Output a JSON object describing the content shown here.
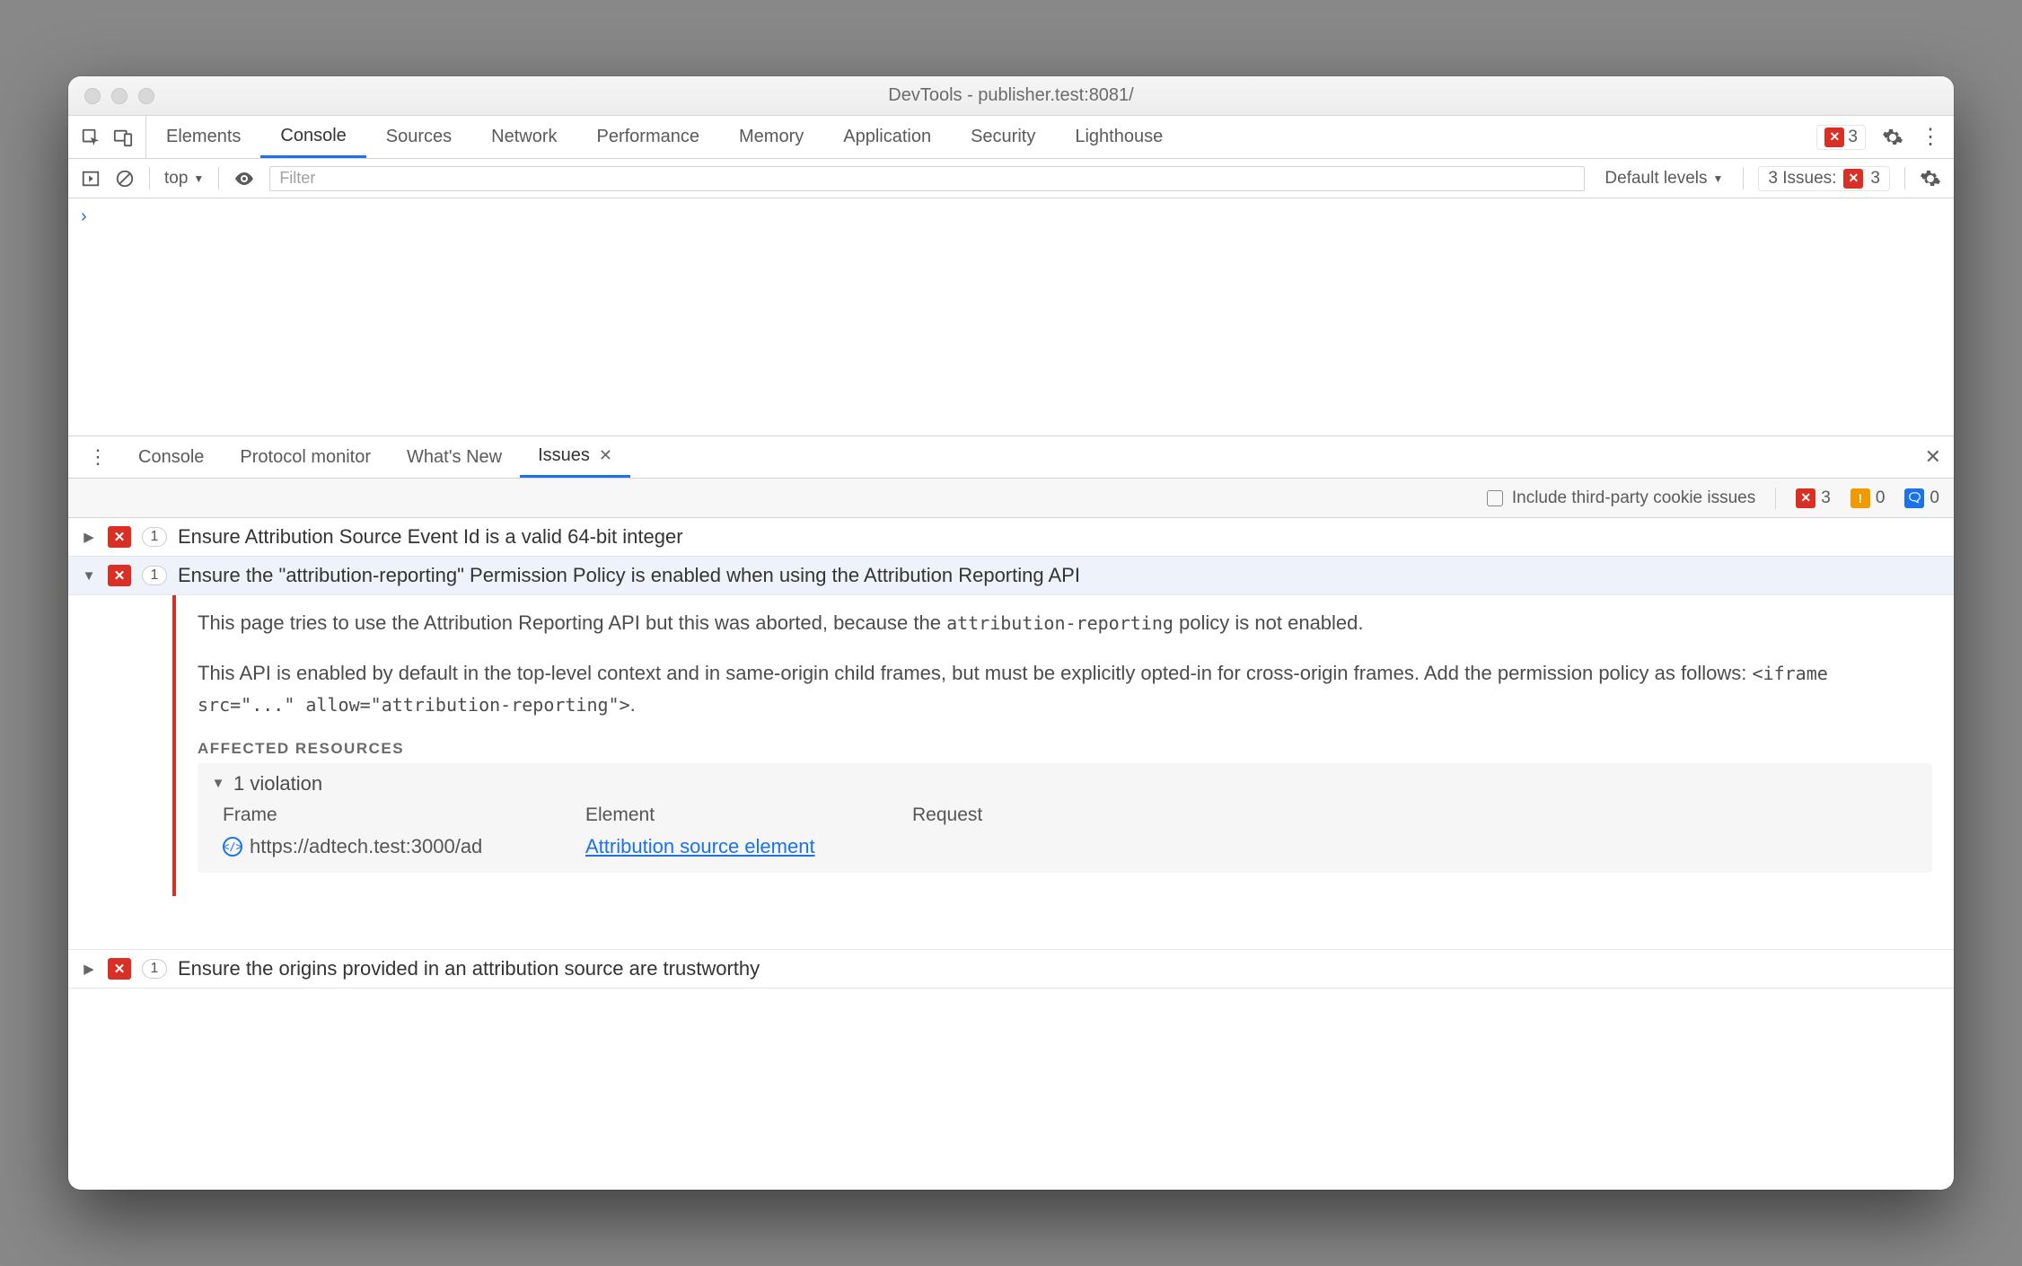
{
  "window": {
    "title": "DevTools - publisher.test:8081/"
  },
  "top_tabs": [
    "Elements",
    "Console",
    "Sources",
    "Network",
    "Performance",
    "Memory",
    "Application",
    "Security",
    "Lighthouse"
  ],
  "top_active": "Console",
  "top_error_count": "3",
  "console_toolbar": {
    "context": "top",
    "filter_placeholder": "Filter",
    "levels": "Default levels",
    "issues_label": "3 Issues:",
    "issues_count": "3"
  },
  "drawer_tabs": [
    "Console",
    "Protocol monitor",
    "What's New",
    "Issues"
  ],
  "drawer_active": "Issues",
  "filterbar": {
    "checkbox_label": "Include third-party cookie issues",
    "counts": {
      "red": "3",
      "orange": "0",
      "blue": "0"
    }
  },
  "issues": [
    {
      "count": "1",
      "title": "Ensure Attribution Source Event Id is a valid 64-bit integer"
    },
    {
      "count": "1",
      "title": "Ensure the \"attribution-reporting\" Permission Policy is enabled when using the Attribution Reporting API"
    },
    {
      "count": "1",
      "title": "Ensure the origins provided in an attribution source are trustworthy"
    }
  ],
  "detail": {
    "p1a": "This page tries to use the Attribution Reporting API but this was aborted, because the ",
    "p1code": "attribution-reporting",
    "p1b": " policy is not enabled.",
    "p2a": "This API is enabled by default in the top-level context and in same-origin child frames, but must be explicitly opted-in for cross-origin frames. Add the permission policy as follows: ",
    "p2code": "<iframe src=\"...\" allow=\"attribution-reporting\">",
    "p2b": ".",
    "affected_header": "Affected Resources",
    "violation_label": "1 violation",
    "cols": {
      "frame": "Frame",
      "element": "Element",
      "request": "Request"
    },
    "row": {
      "frame": "https://adtech.test:3000/ad",
      "element": "Attribution source element",
      "request": ""
    }
  }
}
